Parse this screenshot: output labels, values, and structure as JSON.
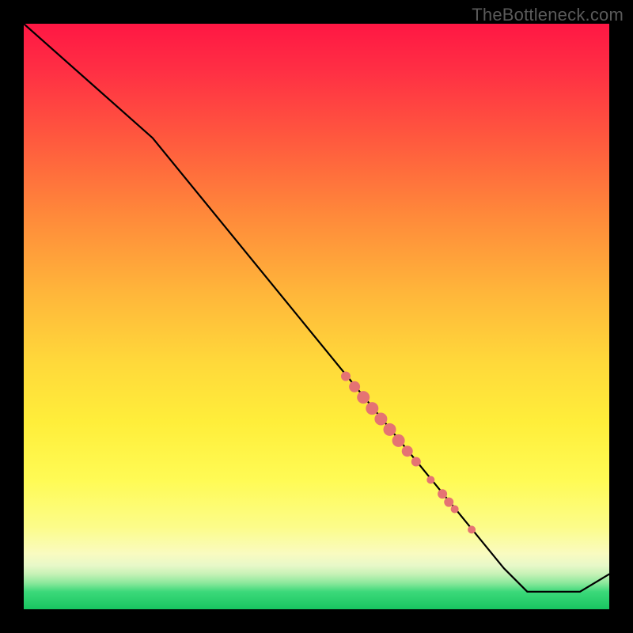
{
  "watermark": "TheBottleneck.com",
  "chart_data": {
    "type": "line",
    "title": "",
    "xlabel": "",
    "ylabel": "",
    "xlim": [
      0,
      100
    ],
    "ylim": [
      0,
      100
    ],
    "series": [
      {
        "name": "curve",
        "x": [
          0,
          22,
          82,
          86,
          95,
          100
        ],
        "values": [
          100,
          80.5,
          7,
          3,
          3,
          6
        ]
      }
    ],
    "markers": [
      {
        "x": 55,
        "y": 39.8,
        "r": 6
      },
      {
        "x": 56.5,
        "y": 38.0,
        "r": 7
      },
      {
        "x": 58,
        "y": 36.2,
        "r": 8
      },
      {
        "x": 59.5,
        "y": 34.3,
        "r": 8
      },
      {
        "x": 61,
        "y": 32.5,
        "r": 8
      },
      {
        "x": 62.5,
        "y": 30.7,
        "r": 8
      },
      {
        "x": 64,
        "y": 28.8,
        "r": 8
      },
      {
        "x": 65.5,
        "y": 27.0,
        "r": 7
      },
      {
        "x": 67,
        "y": 25.2,
        "r": 6
      },
      {
        "x": 69.5,
        "y": 22.1,
        "r": 5
      },
      {
        "x": 71.5,
        "y": 19.7,
        "r": 6
      },
      {
        "x": 72.6,
        "y": 18.3,
        "r": 6
      },
      {
        "x": 73.6,
        "y": 17.1,
        "r": 5
      },
      {
        "x": 76.5,
        "y": 13.6,
        "r": 5
      }
    ],
    "marker_color": "#e57373",
    "line_color": "#000000",
    "line_width": 2.2
  }
}
